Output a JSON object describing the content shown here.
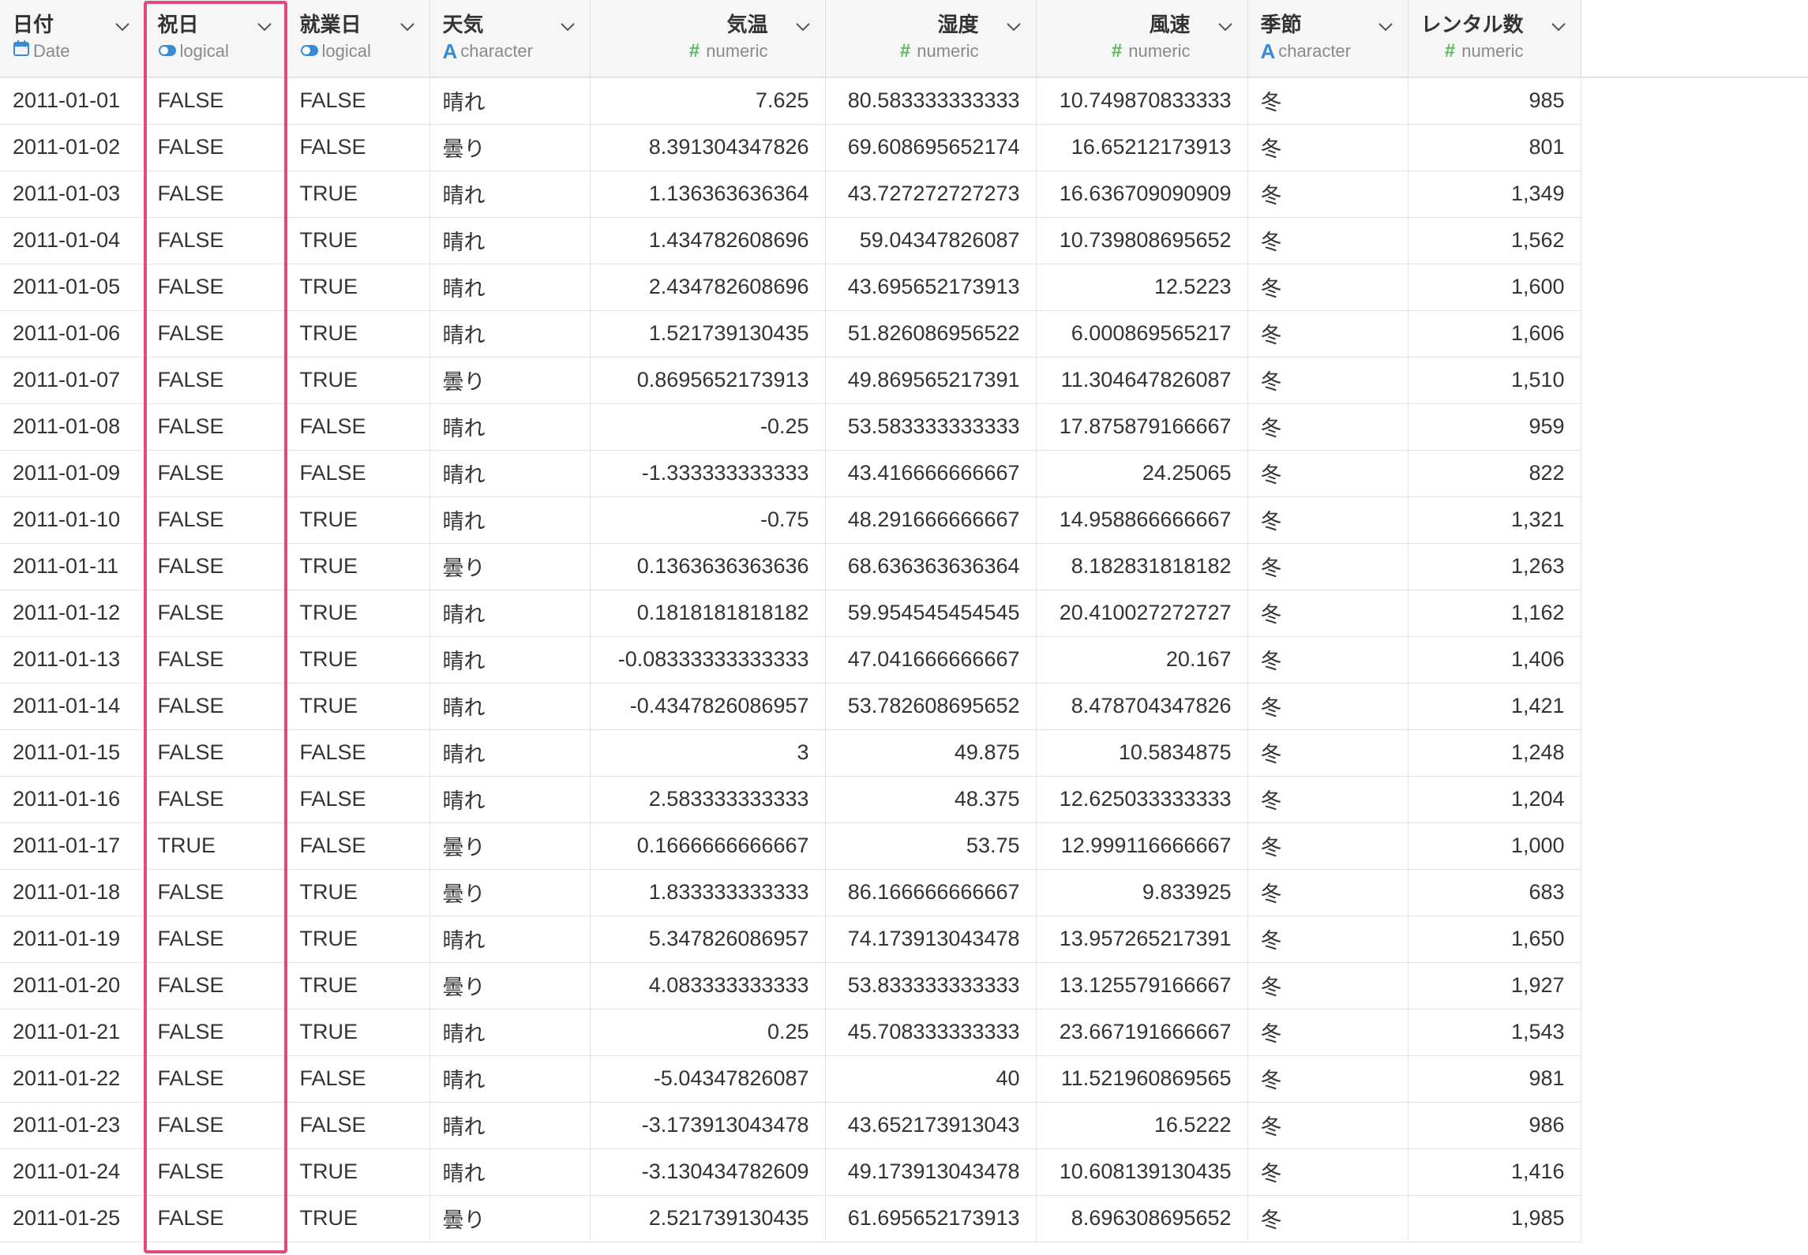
{
  "columns": [
    {
      "name": "日付",
      "type": "Date",
      "icon": "calendar-icon",
      "align": "left"
    },
    {
      "name": "祝日",
      "type": "logical",
      "icon": "toggle-icon",
      "align": "left"
    },
    {
      "name": "就業日",
      "type": "logical",
      "icon": "toggle-icon",
      "align": "left"
    },
    {
      "name": "天気",
      "type": "character",
      "icon": "character-a-icon",
      "align": "left"
    },
    {
      "name": "気温",
      "type": "numeric",
      "icon": "hash-icon",
      "align": "right"
    },
    {
      "name": "湿度",
      "type": "numeric",
      "icon": "hash-icon",
      "align": "right"
    },
    {
      "name": "風速",
      "type": "numeric",
      "icon": "hash-icon",
      "align": "right"
    },
    {
      "name": "季節",
      "type": "character",
      "icon": "character-a-icon",
      "align": "left"
    },
    {
      "name": "レンタル数",
      "type": "numeric",
      "icon": "hash-icon",
      "align": "right"
    }
  ],
  "icon_glyphs": {
    "hash": "#",
    "character": "A"
  },
  "colors": {
    "highlight_border": "#e24b79",
    "type_icon_blue": "#3a8bd6",
    "numeric_icon_green": "#5cb85c"
  },
  "rows": [
    [
      "2011-01-01",
      "FALSE",
      "FALSE",
      "晴れ",
      "7.625",
      "80.583333333333",
      "10.749870833333",
      "冬",
      "985"
    ],
    [
      "2011-01-02",
      "FALSE",
      "FALSE",
      "曇り",
      "8.391304347826",
      "69.608695652174",
      "16.65212173913",
      "冬",
      "801"
    ],
    [
      "2011-01-03",
      "FALSE",
      "TRUE",
      "晴れ",
      "1.136363636364",
      "43.727272727273",
      "16.636709090909",
      "冬",
      "1,349"
    ],
    [
      "2011-01-04",
      "FALSE",
      "TRUE",
      "晴れ",
      "1.434782608696",
      "59.04347826087",
      "10.739808695652",
      "冬",
      "1,562"
    ],
    [
      "2011-01-05",
      "FALSE",
      "TRUE",
      "晴れ",
      "2.434782608696",
      "43.695652173913",
      "12.5223",
      "冬",
      "1,600"
    ],
    [
      "2011-01-06",
      "FALSE",
      "TRUE",
      "晴れ",
      "1.521739130435",
      "51.826086956522",
      "6.000869565217",
      "冬",
      "1,606"
    ],
    [
      "2011-01-07",
      "FALSE",
      "TRUE",
      "曇り",
      "0.8695652173913",
      "49.869565217391",
      "11.304647826087",
      "冬",
      "1,510"
    ],
    [
      "2011-01-08",
      "FALSE",
      "FALSE",
      "晴れ",
      "-0.25",
      "53.583333333333",
      "17.875879166667",
      "冬",
      "959"
    ],
    [
      "2011-01-09",
      "FALSE",
      "FALSE",
      "晴れ",
      "-1.333333333333",
      "43.416666666667",
      "24.25065",
      "冬",
      "822"
    ],
    [
      "2011-01-10",
      "FALSE",
      "TRUE",
      "晴れ",
      "-0.75",
      "48.291666666667",
      "14.958866666667",
      "冬",
      "1,321"
    ],
    [
      "2011-01-11",
      "FALSE",
      "TRUE",
      "曇り",
      "0.1363636363636",
      "68.636363636364",
      "8.182831818182",
      "冬",
      "1,263"
    ],
    [
      "2011-01-12",
      "FALSE",
      "TRUE",
      "晴れ",
      "0.1818181818182",
      "59.954545454545",
      "20.410027272727",
      "冬",
      "1,162"
    ],
    [
      "2011-01-13",
      "FALSE",
      "TRUE",
      "晴れ",
      "-0.08333333333333",
      "47.041666666667",
      "20.167",
      "冬",
      "1,406"
    ],
    [
      "2011-01-14",
      "FALSE",
      "TRUE",
      "晴れ",
      "-0.4347826086957",
      "53.782608695652",
      "8.478704347826",
      "冬",
      "1,421"
    ],
    [
      "2011-01-15",
      "FALSE",
      "FALSE",
      "晴れ",
      "3",
      "49.875",
      "10.5834875",
      "冬",
      "1,248"
    ],
    [
      "2011-01-16",
      "FALSE",
      "FALSE",
      "晴れ",
      "2.583333333333",
      "48.375",
      "12.625033333333",
      "冬",
      "1,204"
    ],
    [
      "2011-01-17",
      "TRUE",
      "FALSE",
      "曇り",
      "0.1666666666667",
      "53.75",
      "12.999116666667",
      "冬",
      "1,000"
    ],
    [
      "2011-01-18",
      "FALSE",
      "TRUE",
      "曇り",
      "1.833333333333",
      "86.166666666667",
      "9.833925",
      "冬",
      "683"
    ],
    [
      "2011-01-19",
      "FALSE",
      "TRUE",
      "晴れ",
      "5.347826086957",
      "74.173913043478",
      "13.957265217391",
      "冬",
      "1,650"
    ],
    [
      "2011-01-20",
      "FALSE",
      "TRUE",
      "曇り",
      "4.083333333333",
      "53.833333333333",
      "13.125579166667",
      "冬",
      "1,927"
    ],
    [
      "2011-01-21",
      "FALSE",
      "TRUE",
      "晴れ",
      "0.25",
      "45.708333333333",
      "23.667191666667",
      "冬",
      "1,543"
    ],
    [
      "2011-01-22",
      "FALSE",
      "FALSE",
      "晴れ",
      "-5.04347826087",
      "40",
      "11.521960869565",
      "冬",
      "981"
    ],
    [
      "2011-01-23",
      "FALSE",
      "FALSE",
      "晴れ",
      "-3.173913043478",
      "43.652173913043",
      "16.5222",
      "冬",
      "986"
    ],
    [
      "2011-01-24",
      "FALSE",
      "TRUE",
      "晴れ",
      "-3.130434782609",
      "49.173913043478",
      "10.608139130435",
      "冬",
      "1,416"
    ],
    [
      "2011-01-25",
      "FALSE",
      "TRUE",
      "曇り",
      "2.521739130435",
      "61.695652173913",
      "8.696308695652",
      "冬",
      "1,985"
    ]
  ]
}
